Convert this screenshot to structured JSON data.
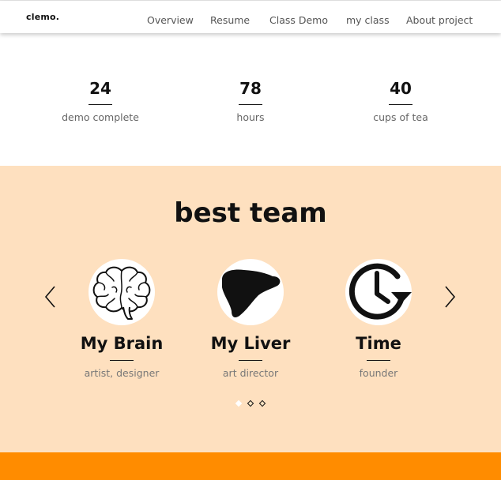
{
  "header": {
    "logo": "clemo.",
    "nav": [
      "Overview",
      "Resume",
      "Class Demo",
      "my class",
      "About project"
    ]
  },
  "stats": [
    {
      "value": "24",
      "label": "demo complete"
    },
    {
      "value": "78",
      "label": "hours"
    },
    {
      "value": "40",
      "label": "cups of tea"
    }
  ],
  "team": {
    "title": "best team",
    "members": [
      {
        "name": "My Brain",
        "role": "artist, designer",
        "icon": "brain-icon"
      },
      {
        "name": "My Liver",
        "role": "art director",
        "icon": "liver-icon"
      },
      {
        "name": "Time",
        "role": "founder",
        "icon": "clock-icon"
      }
    ],
    "pagination": {
      "active": 1,
      "total": 3
    }
  },
  "colors": {
    "team_bg": "#fee0bf",
    "footer_band": "#ff8c00"
  }
}
